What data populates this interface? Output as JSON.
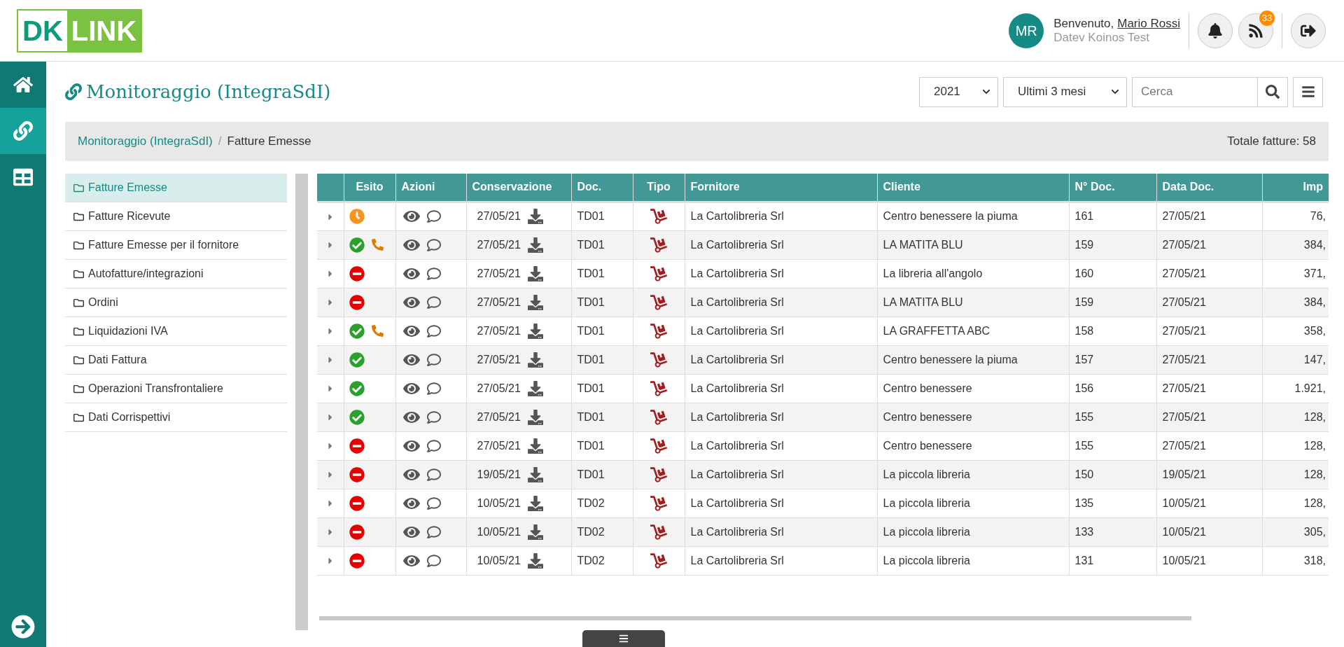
{
  "logo": {
    "left": "DK",
    "right": "LINK"
  },
  "user": {
    "initials": "MR",
    "greeting": "Benvenuto,",
    "name": "Mario Rossi",
    "company": "Datev Koinos Test",
    "feed_badge": "33"
  },
  "sidebar": {
    "items": [
      {
        "kind": "home",
        "selected": false
      },
      {
        "kind": "link",
        "selected": true
      },
      {
        "kind": "table",
        "selected": false
      }
    ]
  },
  "page_title": "Monitoraggio (IntegraSdI)",
  "filters": {
    "year": "2021",
    "period": "Ultimi 3 mesi",
    "search_placeholder": "Cerca"
  },
  "breadcrumb": {
    "separator": "/",
    "items": [
      "Monitoraggio (IntegraSdI)",
      "Fatture Emesse"
    ],
    "total": "Totale fatture: 58"
  },
  "nav": [
    {
      "label": "Fatture Emesse",
      "selected": true
    },
    {
      "label": "Fatture Ricevute",
      "selected": false
    },
    {
      "label": "Fatture Emesse per il fornitore",
      "selected": false
    },
    {
      "label": "Autofatture/integrazioni",
      "selected": false
    },
    {
      "label": "Ordini",
      "selected": false
    },
    {
      "label": "Liquidazioni IVA",
      "selected": false
    },
    {
      "label": "Dati Fattura",
      "selected": false
    },
    {
      "label": "Operazioni Transfrontaliere",
      "selected": false
    },
    {
      "label": "Dati Corrispettivi",
      "selected": false
    }
  ],
  "table": {
    "columns": [
      "Esito",
      "Azioni",
      "Conservazione",
      "Doc.",
      "Tipo",
      "Fornitore",
      "Cliente",
      "N° Doc.",
      "Data Doc.",
      "Imp"
    ],
    "rows": [
      {
        "kind": "pending",
        "phone": false,
        "conservazione": "27/05/21",
        "doc": "TD01",
        "fornitore": "La Cartolibreria Srl",
        "cliente": "Centro benessere la piuma",
        "numero": "161",
        "data": "27/05/21",
        "importo": "76,"
      },
      {
        "kind": "ok",
        "phone": true,
        "conservazione": "27/05/21",
        "doc": "TD01",
        "fornitore": "La Cartolibreria Srl",
        "cliente": "LA MATITA BLU",
        "numero": "159",
        "data": "27/05/21",
        "importo": "384,"
      },
      {
        "kind": "error",
        "phone": false,
        "conservazione": "27/05/21",
        "doc": "TD01",
        "fornitore": "La Cartolibreria Srl",
        "cliente": "La libreria all'angolo",
        "numero": "160",
        "data": "27/05/21",
        "importo": "371,"
      },
      {
        "kind": "error",
        "phone": false,
        "conservazione": "27/05/21",
        "doc": "TD01",
        "fornitore": "La Cartolibreria Srl",
        "cliente": "LA MATITA BLU",
        "numero": "159",
        "data": "27/05/21",
        "importo": "384,"
      },
      {
        "kind": "ok",
        "phone": true,
        "conservazione": "27/05/21",
        "doc": "TD01",
        "fornitore": "La Cartolibreria Srl",
        "cliente": "LA GRAFFETTA ABC",
        "numero": "158",
        "data": "27/05/21",
        "importo": "358,"
      },
      {
        "kind": "ok",
        "phone": false,
        "conservazione": "27/05/21",
        "doc": "TD01",
        "fornitore": "La Cartolibreria Srl",
        "cliente": "Centro benessere la piuma",
        "numero": "157",
        "data": "27/05/21",
        "importo": "147,"
      },
      {
        "kind": "ok",
        "phone": false,
        "conservazione": "27/05/21",
        "doc": "TD01",
        "fornitore": "La Cartolibreria Srl",
        "cliente": "Centro benessere",
        "numero": "156",
        "data": "27/05/21",
        "importo": "1.921,"
      },
      {
        "kind": "ok",
        "phone": false,
        "conservazione": "27/05/21",
        "doc": "TD01",
        "fornitore": "La Cartolibreria Srl",
        "cliente": "Centro benessere",
        "numero": "155",
        "data": "27/05/21",
        "importo": "128,"
      },
      {
        "kind": "error",
        "phone": false,
        "conservazione": "27/05/21",
        "doc": "TD01",
        "fornitore": "La Cartolibreria Srl",
        "cliente": "Centro benessere",
        "numero": "155",
        "data": "27/05/21",
        "importo": "128,"
      },
      {
        "kind": "error",
        "phone": false,
        "conservazione": "19/05/21",
        "doc": "TD01",
        "fornitore": "La Cartolibreria Srl",
        "cliente": "La piccola libreria",
        "numero": "150",
        "data": "19/05/21",
        "importo": "128,"
      },
      {
        "kind": "error",
        "phone": false,
        "conservazione": "10/05/21",
        "doc": "TD02",
        "fornitore": "La Cartolibreria Srl",
        "cliente": "La piccola libreria",
        "numero": "135",
        "data": "10/05/21",
        "importo": "128,"
      },
      {
        "kind": "error",
        "phone": false,
        "conservazione": "10/05/21",
        "doc": "TD02",
        "fornitore": "La Cartolibreria Srl",
        "cliente": "La piccola libreria",
        "numero": "133",
        "data": "10/05/21",
        "importo": "305,"
      },
      {
        "kind": "error",
        "phone": false,
        "conservazione": "10/05/21",
        "doc": "TD02",
        "fornitore": "La Cartolibreria Srl",
        "cliente": "La piccola libreria",
        "numero": "131",
        "data": "10/05/21",
        "importo": "318,"
      }
    ]
  }
}
